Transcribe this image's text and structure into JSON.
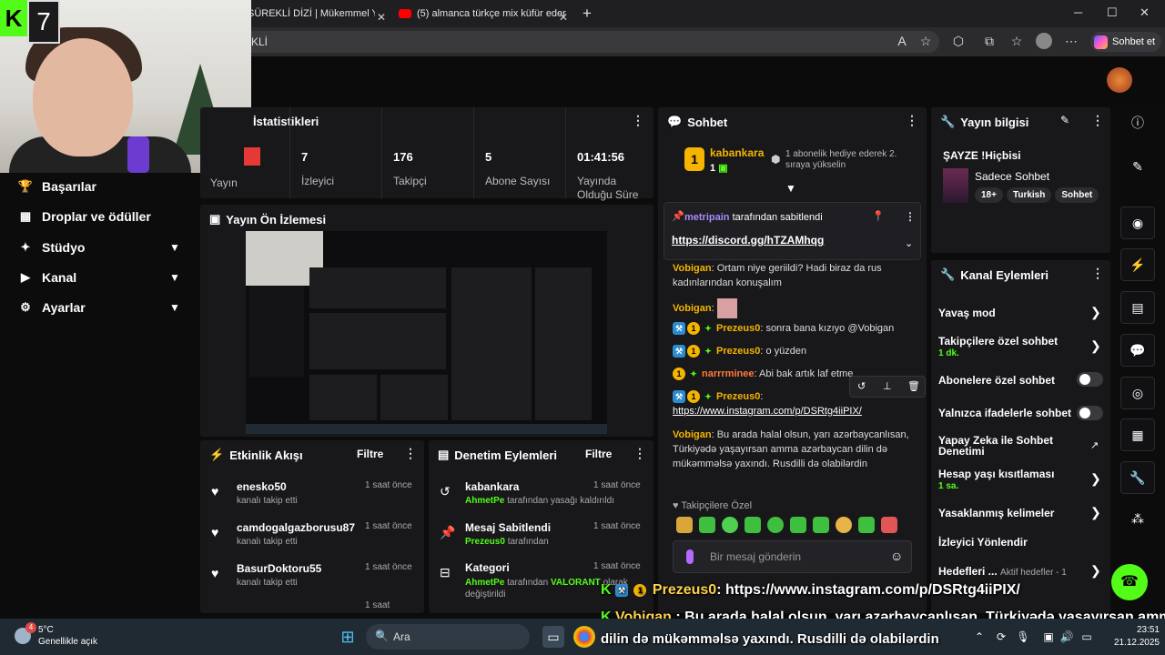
{
  "browser": {
    "tabs": [
      {
        "title": "SÜREKLİ DİZİ | Mükemmel Yu"
      },
      {
        "title": "(5) almanca türkçe mix küfür eder"
      }
    ],
    "new_tab": "+",
    "address": "KLİ",
    "copilot_label": "Sohbet et"
  },
  "webcam": {
    "overlay_number": "7",
    "logo": "K"
  },
  "nav": {
    "items": [
      {
        "label": "Başarılar"
      },
      {
        "label": "Droplar ve ödüller"
      },
      {
        "label": "Stüdyo"
      },
      {
        "label": "Kanal"
      },
      {
        "label": "Ayarlar"
      }
    ]
  },
  "stats": {
    "title": "İstatistikleri",
    "first_label": "Yayın",
    "items": [
      {
        "value": "7",
        "label": "İzleyici"
      },
      {
        "value": "176",
        "label": "Takipçi"
      },
      {
        "value": "5",
        "label": "Abone Sayısı"
      },
      {
        "value": "01:41:56",
        "label": "Yayında Olduğu Süre"
      }
    ]
  },
  "preview": {
    "title": "Yayın Ön İzlemesi"
  },
  "activity": {
    "title": "Etkinlik Akışı",
    "filter": "Filtre",
    "items": [
      {
        "user": "enesko50",
        "action": "kanalı takip etti",
        "time": "1 saat önce"
      },
      {
        "user": "camdogalgazborusu87",
        "action": "kanalı takip etti",
        "time": "1 saat önce"
      },
      {
        "user": "BasurDoktoru55",
        "action": "kanalı takip etti",
        "time": "1 saat önce"
      },
      {
        "user": "",
        "action": "",
        "time": "1 saat"
      }
    ]
  },
  "moderation": {
    "title": "Denetim Eylemleri",
    "filter": "Filtre",
    "items": [
      {
        "title": "kabankara",
        "actor": "AhmetPe",
        "rest": "tarafından yasağı kaldırıldı",
        "time": "1 saat önce"
      },
      {
        "title": "Mesaj Sabitlendi",
        "actor": "Prezeus0",
        "rest": "tarafından",
        "time": "1 saat önce"
      },
      {
        "title": "Kategori",
        "actor": "AhmetPe",
        "rest_a": "tarafından",
        "game": "VALORANT",
        "rest_b": "olarak değiştirildi",
        "time": "1 saat önce"
      }
    ]
  },
  "chat": {
    "title": "Sohbet",
    "top_gifter": {
      "name": "kabankara",
      "count": "1",
      "rank": "1",
      "promo": "1 abonelik hediye ederek 2. sıraya yükselin"
    },
    "pinned": {
      "by_user": "metripain",
      "by_text": "tarafından sabitlendi",
      "link": "https://discord.gg/hTZAMhqg"
    },
    "messages": [
      {
        "user": "Vobigan",
        "text": "Ortam niye geriildi? Hadi biraz da rus kadınlarından konuşalım"
      },
      {
        "user": "Vobigan",
        "text": ""
      },
      {
        "user": "Prezeus0",
        "text": "sonra bana kızıyo @Vobigan"
      },
      {
        "user": "Prezeus0",
        "text": "o yüzden"
      },
      {
        "user": "narrrminee",
        "text": "Abi bak artık laf etme"
      },
      {
        "user": "Prezeus0",
        "text": "https://www.instagram.com/p/DSRtg4iiPIX/"
      },
      {
        "user": "Vobigan",
        "text": "Bu arada halal olsun, yarı azərbaycanlısan, Türkiyədə yaşayırsan amma azərbaycan dilin də mükəmməlsə yaxındı. Rusdilli də olabilərdin"
      }
    ],
    "emote_tab": "Takipçilere Özel",
    "input_placeholder": "Bir mesaj gönderin"
  },
  "stream_info": {
    "title": "Yayın bilgisi",
    "stream_title": "ŞAYZE !Hiçbisi",
    "category": "Sadece Sohbet",
    "tags": [
      "18+",
      "Turkish",
      "Sohbet"
    ]
  },
  "channel_actions": {
    "title": "Kanal Eylemleri",
    "items": [
      {
        "label": "Yavaş mod",
        "sub": ""
      },
      {
        "label": "Takipçilere özel sohbet",
        "sub": "1 dk."
      },
      {
        "label": "Abonelere özel sohbet",
        "sub": ""
      },
      {
        "label": "Yalnızca ifadelerle sohbet",
        "sub": ""
      },
      {
        "label": "Yapay Zeka ile Sohbet Denetimi",
        "sub": ""
      },
      {
        "label": "Hesap yaşı kısıtlaması",
        "sub": "1 sa."
      },
      {
        "label": "Yasaklanmış kelimeler",
        "sub": ""
      },
      {
        "label": "İzleyici Yönlendir",
        "sub": ""
      },
      {
        "label": "Hedefleri ...",
        "sub": "",
        "extra": "Aktif hedefler - 1"
      }
    ]
  },
  "stream_overlay": {
    "user1": "Prezeus0",
    "msg1": "https://www.instagram.com/p/DSRtg4iiPIX/",
    "user2": "Vobigan",
    "msg2a": "Bu arada halal olsun, yarı azərbaycanlısan, Türkiyədə yaşayırsan amma az",
    "msg2b": "dilin də mükəmməlsə yaxındı. Rusdilli də olabilərdin"
  },
  "taskbar": {
    "temp": "5°C",
    "weather": "Genellikle açık",
    "weather_badge": "4",
    "search": "Ara",
    "time": "23:51",
    "date": "21.12.2025"
  },
  "colors": {
    "accent": "#53fc18",
    "panel": "#18181b",
    "gold": "#f4b400"
  }
}
